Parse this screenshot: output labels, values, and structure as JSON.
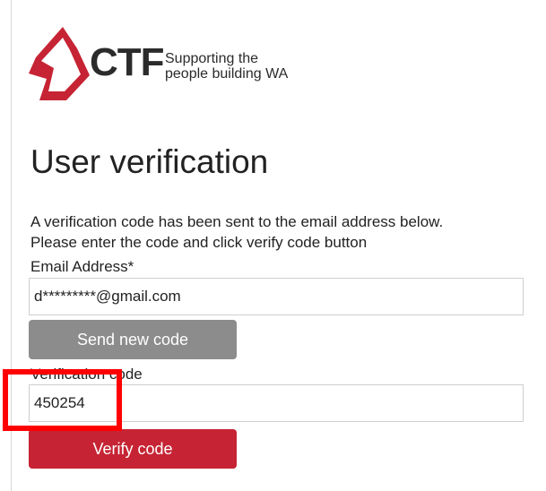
{
  "brand": {
    "logo_text": "CTF",
    "tagline": "Supporting the\npeople building WA",
    "logo_color": "#c62434"
  },
  "page": {
    "title": "User verification",
    "intro_line1": "A verification code has been sent to the email address below.",
    "intro_line2": "Please enter the code and click verify code button"
  },
  "email": {
    "label": "Email Address*",
    "value": "d*********@gmail.com"
  },
  "send_button": {
    "label": "Send new code",
    "color": "#8c8c8c"
  },
  "verification": {
    "label": "Verification code",
    "value": "450254"
  },
  "verify_button": {
    "label": "Verify code",
    "color": "#c62434"
  },
  "annotation": {
    "highlight_color": "#ff0000"
  }
}
